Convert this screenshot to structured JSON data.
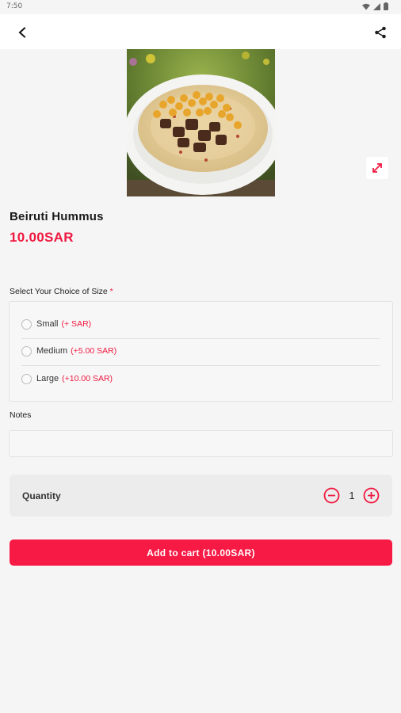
{
  "status_bar": {
    "time": "7:50"
  },
  "product": {
    "name": "Beiruti Hummus",
    "price": "10.00SAR"
  },
  "size_section": {
    "label": "Select Your Choice of Size",
    "required_mark": "*",
    "options": [
      {
        "name": "Small",
        "extra": "(+ SAR)"
      },
      {
        "name": "Medium",
        "extra": "(+5.00 SAR)"
      },
      {
        "name": "Large",
        "extra": "(+10.00 SAR)"
      }
    ]
  },
  "notes": {
    "label": "Notes",
    "value": "",
    "placeholder": ""
  },
  "quantity": {
    "label": "Quantity",
    "value": "1"
  },
  "add_to_cart": {
    "label": "Add to cart (10.00SAR)"
  },
  "colors": {
    "accent": "#f0183f",
    "button": "#f71a44",
    "background": "#f5f5f5"
  },
  "icons": [
    "back-arrow-icon",
    "share-icon",
    "expand-icon",
    "minus-circle-icon",
    "plus-circle-icon",
    "wifi-icon",
    "signal-icon",
    "battery-icon"
  ]
}
